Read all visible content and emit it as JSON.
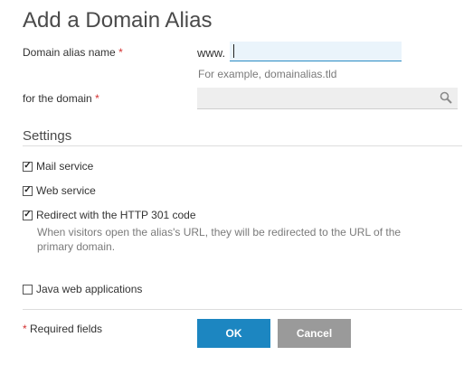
{
  "dialog": {
    "title": "Add a Domain Alias"
  },
  "form": {
    "alias_label": "Domain alias name",
    "required_mark": "*",
    "prefix": "www.",
    "alias_value": "",
    "alias_hint": "For example, domainalias.tld",
    "domain_label": "for the domain",
    "domain_value": ""
  },
  "settings": {
    "heading": "Settings",
    "options": [
      {
        "label": "Mail service",
        "checked": true
      },
      {
        "label": "Web service",
        "checked": true
      },
      {
        "label": "Redirect with the HTTP 301 code",
        "checked": true
      },
      {
        "label": "Java web applications",
        "checked": false
      }
    ],
    "redirect_description": "When visitors open the alias's URL, they will be redirected to the URL of the primary domain."
  },
  "footer": {
    "required_note": "Required fields",
    "ok_label": "OK",
    "cancel_label": "Cancel"
  },
  "colors": {
    "accent": "#1c86c1",
    "required": "#d32f2f",
    "cancel": "#9a9a9a"
  },
  "icons": {
    "domain_lookup": "search-icon",
    "checkmark": "check-icon"
  }
}
